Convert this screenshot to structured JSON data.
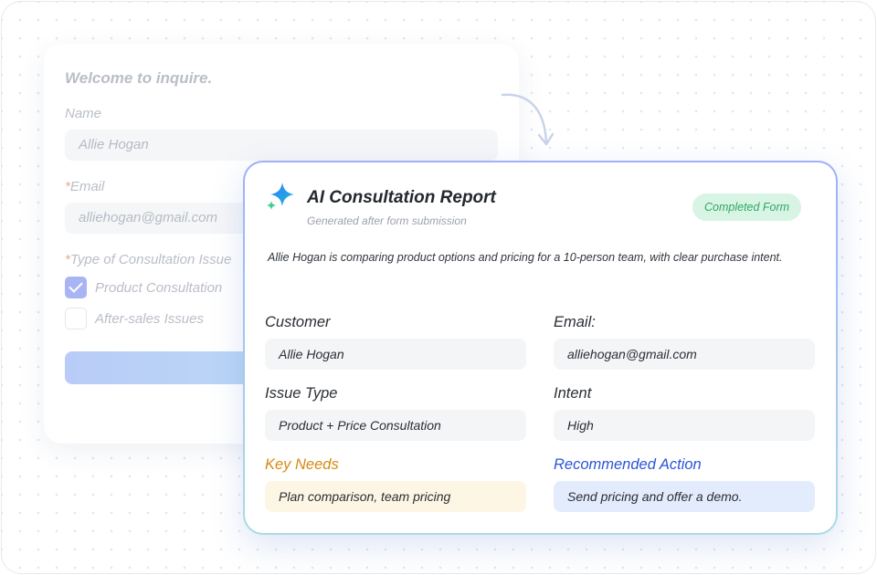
{
  "form": {
    "title": "Welcome to inquire.",
    "name_label": "Name",
    "name_value": "Allie Hogan",
    "email_required_mark": "*",
    "email_label": "Email",
    "email_value": "alliehogan@gmail.com",
    "type_required_mark": "*",
    "type_label": "Type of Consultation Issue",
    "options": [
      {
        "label": "Product Consultation",
        "checked": true
      },
      {
        "label": "After-sales Issues",
        "checked": false
      }
    ]
  },
  "report": {
    "title": "AI Consultation Report",
    "subtitle": "Generated after form submission",
    "status": "Completed Form",
    "summary": "Allie Hogan is comparing product options and pricing for a 10-person team, with clear purchase intent.",
    "fields": {
      "customer_label": "Customer",
      "customer_value": "Allie Hogan",
      "email_label": "Email:",
      "email_value": "alliehogan@gmail.com",
      "issue_label": "Issue Type",
      "issue_value": "Product + Price Consultation",
      "intent_label": "Intent",
      "intent_value": "High",
      "needs_label": "Key Needs",
      "needs_value": "Plan comparison, team pricing",
      "action_label": "Recommended Action",
      "action_value": "Send pricing and offer a demo."
    }
  },
  "colors": {
    "accent_blue": "#2c54d6",
    "accent_amber": "#d68a14",
    "status_green": "#2fa765",
    "check_blue": "#a9b5f3"
  },
  "icons": {
    "sparkle": "sparkle-icon",
    "arrow": "curved-arrow-icon",
    "check": "checkmark-icon"
  }
}
